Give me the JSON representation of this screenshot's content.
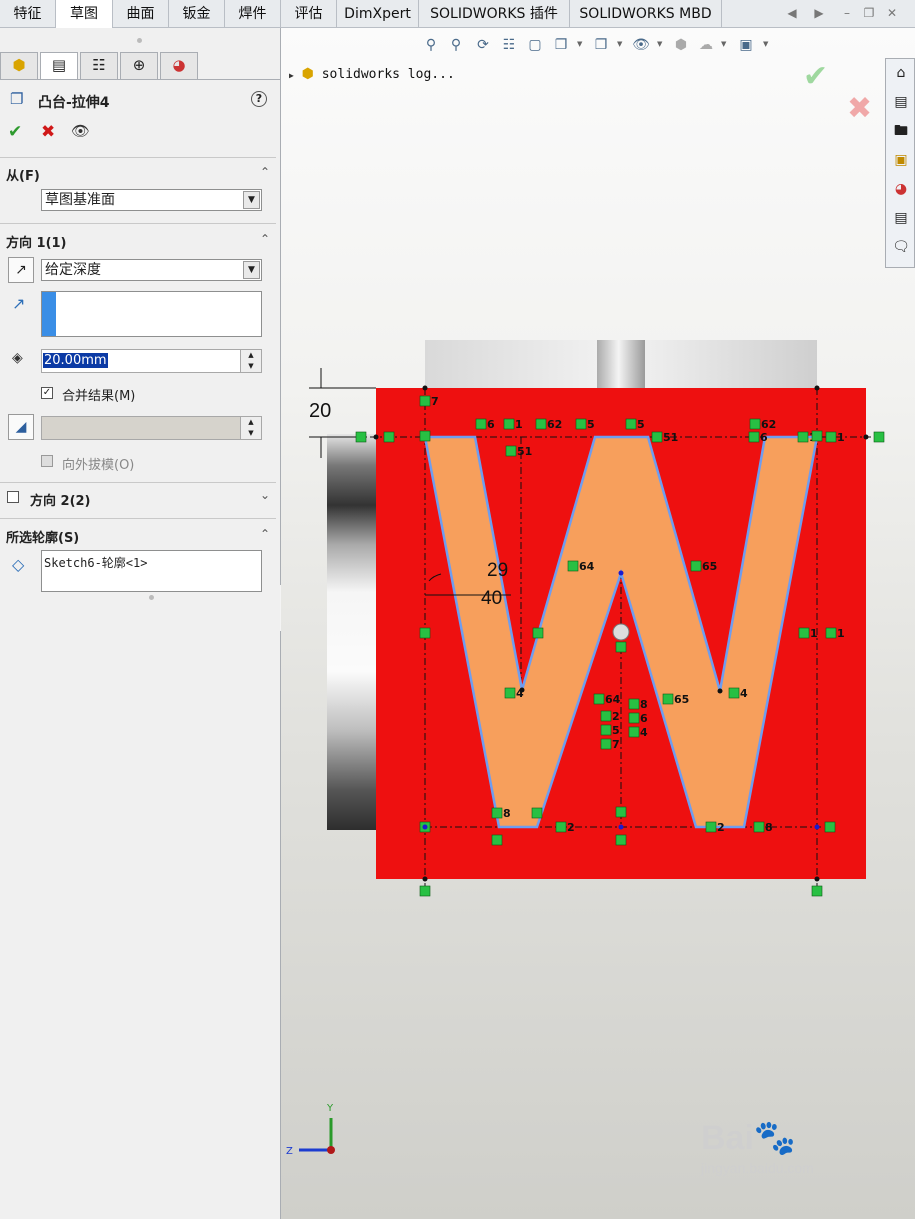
{
  "tabs": [
    "特征",
    "草图",
    "曲面",
    "钣金",
    "焊件",
    "评估",
    "DimXpert",
    "SOLIDWORKS 插件",
    "SOLIDWORKS MBD"
  ],
  "active_tab": 1,
  "property_manager": {
    "title": "凸台-拉伸4",
    "help": "?",
    "from": {
      "label": "从(F)",
      "value": "草图基准面"
    },
    "direction1": {
      "label": "方向 1(1)",
      "end_condition": "给定深度",
      "depth": "20.00mm",
      "merge_label": "合并结果(M)",
      "merge_checked": true,
      "draft_label": "向外拔模(O)",
      "draft_checked": false
    },
    "direction2": {
      "label": "方向 2(2)",
      "checked": false
    },
    "selected_contours": {
      "label": "所选轮廓(S)",
      "item": "Sketch6-轮廓<1>"
    }
  },
  "graphics": {
    "tree_item": "solidworks log...",
    "dimensions": {
      "depth": "20",
      "horizontal": "40",
      "angle": "29"
    },
    "relation_labels": [
      "7",
      "6",
      "1",
      "62",
      "5",
      "5",
      "51",
      "51",
      "62",
      "6",
      "1",
      "1",
      "64",
      "65",
      "4",
      "4",
      "64",
      "65",
      "8",
      "6",
      "4",
      "2",
      "5",
      "7",
      "8",
      "2",
      "2",
      "8",
      "1",
      "1"
    ],
    "axis_y": "Y",
    "axis_z": "Z"
  },
  "colors": {
    "accent_blue": "#3a8ee6",
    "sketch_red": "#ee1010",
    "profile_fill": "#f79f5c",
    "profile_edge": "#6e9df0",
    "relation_green": "#28c043",
    "ok_green": "#2e9a2e",
    "cancel_red": "#d01818"
  },
  "icons": [
    "view-orientation-icon",
    "zoom-fit-icon",
    "zoom-area-icon",
    "previous-view-icon",
    "section-view-icon",
    "view-settings-icon",
    "display-style-icon",
    "hide-show-icon",
    "appearance-icon",
    "scene-icon",
    "display-pane-icon",
    "home-icon",
    "parts-library-icon",
    "file-explorer-icon",
    "view-palette-icon",
    "appearances-scenes-icon",
    "custom-properties-icon",
    "forum-icon"
  ]
}
